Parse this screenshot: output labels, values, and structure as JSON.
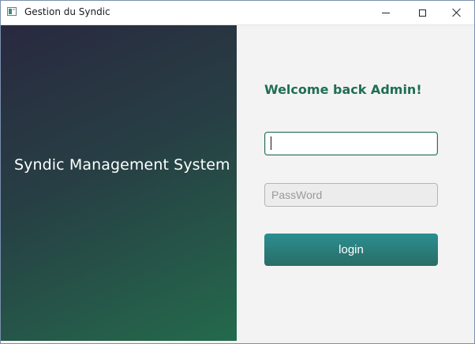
{
  "window": {
    "title": "Gestion du Syndic",
    "app_icon": "app-window-icon",
    "controls": {
      "minimize_icon": "minimize-icon",
      "maximize_icon": "maximize-icon",
      "close_icon": "close-icon"
    }
  },
  "left_panel": {
    "system_title": "Syndic Management System",
    "gradient_colors": [
      "#29293f",
      "#273f44",
      "#246a4c"
    ]
  },
  "login_form": {
    "welcome_text": "Welcome back Admin!",
    "welcome_color": "#1f6e54",
    "username": {
      "value": "",
      "placeholder": ""
    },
    "password": {
      "value": "",
      "placeholder": "PassWord"
    },
    "login_label": "login",
    "button_color": "#2a7f7e"
  }
}
